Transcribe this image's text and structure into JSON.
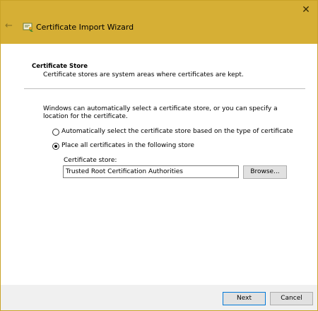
{
  "window": {
    "title": "Certificate Import Wizard",
    "close_glyph": "✕",
    "back_glyph": "←",
    "accent_color": "#d6af35",
    "back_icon": "back-arrow-icon",
    "wizard_icon": "certificate-wizard-icon",
    "close_icon": "close-icon"
  },
  "header": {
    "section_title": "Certificate Store",
    "section_description": "Certificate stores are system areas where certificates are kept."
  },
  "body": {
    "intro": "Windows can automatically select a certificate store, or you can specify a location for the certificate.",
    "options": [
      {
        "label": "Automatically select the certificate store based on the type of certificate",
        "selected": false
      },
      {
        "label": "Place all certificates in the following store",
        "selected": true
      }
    ],
    "store_label": "Certificate store:",
    "store_value": "Trusted Root Certification Authorities",
    "browse_label": "Browse..."
  },
  "footer": {
    "next_label": "Next",
    "cancel_label": "Cancel"
  }
}
